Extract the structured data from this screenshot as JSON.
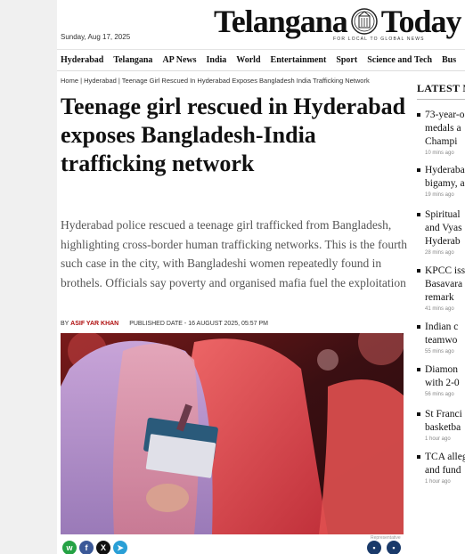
{
  "site": {
    "date": "Sunday, Aug 17, 2025",
    "logo_left": "Telangana",
    "logo_right": "Today",
    "tagline": "FOR LOCAL TO GLOBAL NEWS"
  },
  "nav": [
    "Hyderabad",
    "Telangana",
    "AP News",
    "India",
    "World",
    "Entertainment",
    "Sport",
    "Science and Tech",
    "Bus"
  ],
  "article": {
    "breadcrumb": "Home | Hyderabad | Teenage Girl Rescued In Hyderabad Exposes Bangladesh India Trafficking Network",
    "headline": "Teenage girl rescued in Hyderabad exposes Bangladesh-India trafficking network",
    "summary": "Hyderabad police rescued a teenage girl trafficked from Bangladesh, highlighting cross-border human trafficking networks. This is the fourth such case in the city, with Bangladeshi women repeatedly found in brothels. Officials say poverty and organised mafia fuel the exploitation",
    "by_label": "BY",
    "author": "ASIF YAR KHAN",
    "published": "PUBLISHED DATE - 16 AUGUST 2025, 05:57 PM",
    "image_credit": "Representative"
  },
  "share": [
    "whatsapp-icon",
    "facebook-icon",
    "x-icon",
    "telegram-icon"
  ],
  "sidebar": {
    "heading": "LATEST N",
    "items": [
      {
        "lines": [
          "73-year-o",
          "medals a",
          "Champi"
        ],
        "time": "10 mins ago"
      },
      {
        "lines": [
          "Hyderaba",
          "bigamy, a"
        ],
        "time": "19 mins ago"
      },
      {
        "lines": [
          "Spiritual",
          "and Vyas",
          "Hyderab"
        ],
        "time": "28 mins ago"
      },
      {
        "lines": [
          "KPCC iss",
          "Basavara",
          "remark"
        ],
        "time": "41 mins ago"
      },
      {
        "lines": [
          "Indian c",
          "teamwo"
        ],
        "time": "55 mins ago"
      },
      {
        "lines": [
          "Diamon",
          "with 2-0"
        ],
        "time": "56 mins ago"
      },
      {
        "lines": [
          "St Franci",
          "basketba"
        ],
        "time": "1 hour ago"
      },
      {
        "lines": [
          "TCA alleg",
          "and fund"
        ],
        "time": "1 hour ago"
      }
    ]
  }
}
